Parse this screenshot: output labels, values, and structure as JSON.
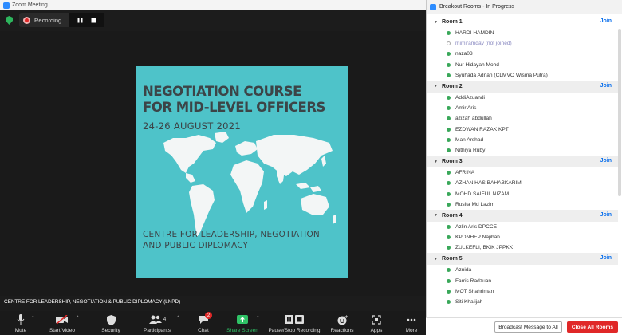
{
  "window": {
    "title": "Zoom Meeting"
  },
  "recording": {
    "label": "Recording..."
  },
  "slide": {
    "title_line1": "NEGOTIATION COURSE",
    "title_line2": "FOR MID-LEVEL OFFICERS",
    "date": "24-26 AUGUST  2021",
    "footer_line1": "CENTRE FOR LEADERSHIP, NEGOTIATION",
    "footer_line2": "AND PUBLIC DIPLOMACY"
  },
  "speaker": {
    "name": "CENTRE FOR LEADERSHIP, NEGOTIATION & PUBLIC DIPLOMACY (LNPD)"
  },
  "toolbar": {
    "mute": "Mute",
    "start_video": "Start Video",
    "security": "Security",
    "participants": "Participants",
    "participants_count": "4",
    "chat": "Chat",
    "chat_badge": "2",
    "share_screen": "Share Screen",
    "pause_stop_recording": "Pause/Stop Recording",
    "reactions": "Reactions",
    "apps": "Apps",
    "more": "More"
  },
  "breakout": {
    "title": "Breakout Rooms - In Progress",
    "join_label": "Join",
    "rooms": [
      {
        "name": "Room 1",
        "members": [
          "HARDI HAMDIN",
          "mimiramday (not joined)",
          "naza03",
          "Nur Hidayah Mohd",
          "Syuhada Adnan (CLMVO Wisma Putra)"
        ]
      },
      {
        "name": "Room 2",
        "members": [
          "AddiAzuandi",
          "Amir Aris",
          "azizah abdullah",
          "EZDWAN RAZAK KPT",
          "Man Arshad",
          "Nithiya Ruby"
        ]
      },
      {
        "name": "Room 3",
        "members": [
          "AFRINA",
          "AZHANIHASIBAHABKARIM",
          "MOHD SAIFUL NIZAM",
          "Rusita Md Lazim"
        ]
      },
      {
        "name": "Room 4",
        "members": [
          "Azlin Aris DPCCE",
          "KPDNHEP Najibah",
          "ZULKEFLI, BKIK JPPKK"
        ]
      },
      {
        "name": "Room 5",
        "members": [
          "Aznida",
          "Farris Radzuan",
          "MOT Shahriman",
          "Siti Khalijah"
        ]
      }
    ],
    "broadcast_label": "Broadcast Message to All",
    "close_all_label": "Close All Rooms"
  },
  "colors": {
    "accent_blue": "#0e72ed",
    "slide_teal": "#4ec3c9",
    "record_red": "#e02828",
    "online_green": "#3aa85a"
  }
}
